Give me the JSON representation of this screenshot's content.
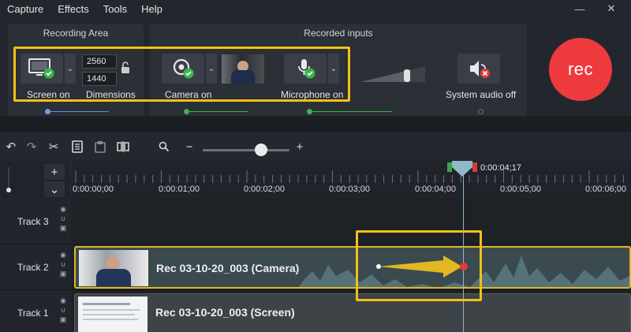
{
  "menu": [
    "Capture",
    "Effects",
    "Tools",
    "Help"
  ],
  "window_controls": {
    "minimize": "—",
    "close": "✕"
  },
  "recording_area": {
    "title": "Recording Area",
    "screen_label": "Screen on",
    "dimensions_label": "Dimensions",
    "width_value": "2560",
    "height_value": "1440"
  },
  "recorded_inputs": {
    "title": "Recorded inputs",
    "camera_label": "Camera on",
    "microphone_label": "Microphone on",
    "system_audio_label": "System audio off",
    "mic_level": 0.72
  },
  "rec_button": "rec",
  "timeline": {
    "playhead_time": "0:00:04;17",
    "ticks": [
      "0:00:00;00",
      "0:00:01;00",
      "0:00:02;00",
      "0:00:03;00",
      "0:00:04;00",
      "0:00:05;00",
      "0:00:06;00"
    ],
    "zoom_level": 0.67,
    "tracks": [
      {
        "name": "Track 3",
        "clip": ""
      },
      {
        "name": "Track 2",
        "clip": "Rec 03-10-20_003 (Camera)"
      },
      {
        "name": "Track 1",
        "clip": "Rec 03-10-20_003 (Screen)"
      }
    ]
  },
  "colors": {
    "accent_yellow": "#f2c018",
    "rec_red": "#ee3a3d",
    "check_green": "#39b54a",
    "audio_off_red": "#e23b3b",
    "waveform": "#4f6b73"
  }
}
